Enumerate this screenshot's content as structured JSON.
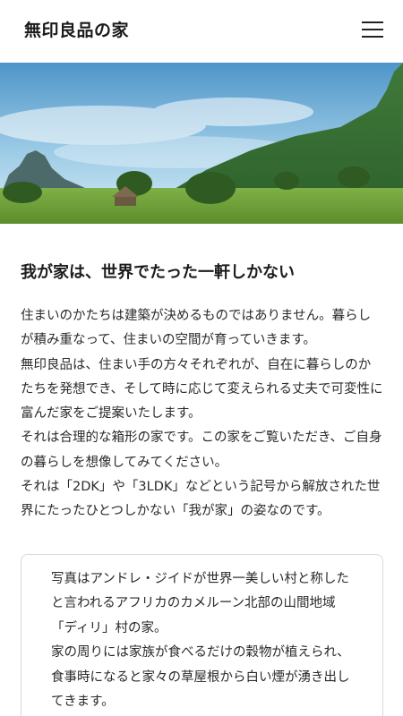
{
  "header": {
    "logo_text": "無印良品の家",
    "menu_icon": "hamburger-menu-icon"
  },
  "hero": {
    "sky_color": "#7fb5d8",
    "grass_color": "#6a9a35"
  },
  "main": {
    "title": "我が家は、世界でたった一軒しかない",
    "paragraphs": [
      "住まいのかたちは建築が決めるものではありません。暮らしが積み重なって、住まいの空間が育っていきます。",
      "無印良品は、住まい手の方々それぞれが、自在に暮らしのかたちを発想でき、そして時に応じて変えられる丈夫で可変性に富んだ家をご提案いたします。",
      "それは合理的な箱形の家です。この家をご覧いただき、ご自身の暮らしを想像してみてください。",
      "それは「2DK」や「3LDK」などという記号から解放された世界にたったひとつしかない「我が家」の姿なのです。"
    ]
  },
  "caption": {
    "paragraphs": [
      "写真はアンドレ・ジイドが世界一美しい村と称したと言われるアフリカのカメルーン北部の山間地域「ディリ」村の家。",
      "家の周りには家族が食べるだけの穀物が植えられ、食事時になると家々の草屋根から白い煙が湧き出してきます。"
    ]
  }
}
